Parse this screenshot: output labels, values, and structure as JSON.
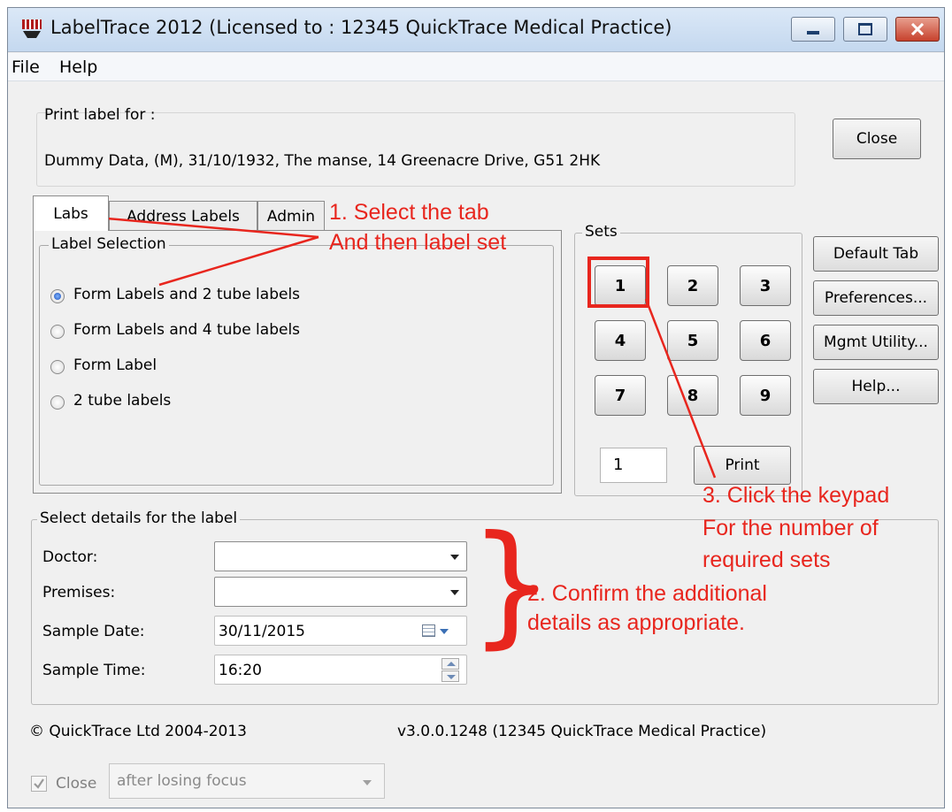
{
  "window": {
    "title": "LabelTrace 2012 (Licensed to : 12345 QuickTrace Medical Practice)"
  },
  "menu": [
    "File",
    "Help"
  ],
  "print_for": {
    "label": "Print label for :",
    "value": "Dummy Data, (M), 31/10/1932, The manse, 14 Greenacre Drive, G51 2HK"
  },
  "close_button": "Close",
  "tabs": [
    "Labs",
    "Address Labels",
    "Admin"
  ],
  "label_selection": {
    "title": "Label Selection",
    "options": [
      {
        "label": "Form Labels and 2 tube labels",
        "selected": true
      },
      {
        "label": "Form Labels and 4 tube labels",
        "selected": false
      },
      {
        "label": "Form Label",
        "selected": false
      },
      {
        "label": "2 tube labels",
        "selected": false
      }
    ]
  },
  "sets": {
    "title": "Sets",
    "keys": [
      "1",
      "2",
      "3",
      "4",
      "5",
      "6",
      "7",
      "8",
      "9"
    ],
    "count_value": "1",
    "print_label": "Print"
  },
  "side_buttons": [
    "Default Tab",
    "Preferences...",
    "Mgmt Utility...",
    "Help..."
  ],
  "details": {
    "title": "Select details for the label",
    "doctor_label": "Doctor:",
    "premises_label": "Premises:",
    "sample_date_label": "Sample Date:",
    "sample_date_value": "30/11/2015",
    "sample_time_label": "Sample Time:",
    "sample_time_value": "16:20"
  },
  "footer": {
    "copyright": "© QuickTrace Ltd 2004-2013",
    "version": "v3.0.0.1248  (12345 QuickTrace Medical Practice)",
    "close_checkbox_label": "Close",
    "close_checked": true,
    "close_option": "after losing focus"
  },
  "annotations": {
    "a1_line1": "1. Select the tab",
    "a1_line2": "And then label set",
    "a2_line1": "2. Confirm the additional",
    "a2_line2": "details as appropriate.",
    "a3_line1": "3. Click the keypad",
    "a3_line2": "For the number of",
    "a3_line3": "required sets",
    "color": "#e8261e"
  },
  "colors": {
    "window_bg": "#f0f0f0",
    "titlebar": "#c4d8ef",
    "annotation_red": "#e8261e"
  }
}
